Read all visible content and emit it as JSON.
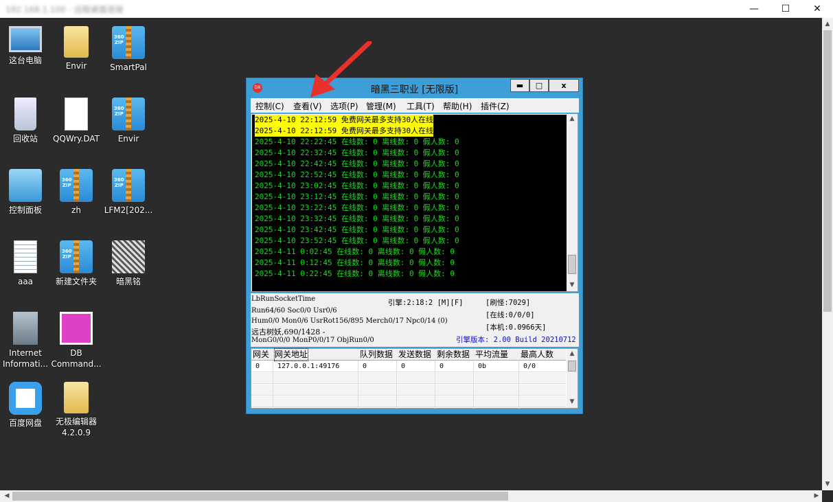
{
  "outer": {
    "title": "192.168.1.100 - 远程桌面连接",
    "minimize": "—",
    "maximize": "☐",
    "close": "✕"
  },
  "desktop_icons": [
    {
      "label": "这台电脑",
      "icon": "computer-icon"
    },
    {
      "label": "Envir",
      "icon": "folder-icon"
    },
    {
      "label": "SmartPal",
      "icon": "zip-icon"
    },
    {
      "label": "回收站",
      "icon": "recycle-bin-icon"
    },
    {
      "label": "QQWry.DAT",
      "icon": "file-icon"
    },
    {
      "label": "Envir",
      "icon": "zip-icon"
    },
    {
      "label": "控制面板",
      "icon": "control-panel-icon"
    },
    {
      "label": "zh",
      "icon": "zip-icon"
    },
    {
      "label": "LFM2[202...",
      "icon": "zip-icon"
    },
    {
      "label": "aaa",
      "icon": "text-file-icon"
    },
    {
      "label": "新建文件夹",
      "icon": "zip-icon"
    },
    {
      "label": "暗黑铭",
      "icon": "dragon-icon"
    },
    {
      "label": "Internet\nInformati...",
      "icon": "iis-icon"
    },
    {
      "label": "DB\nCommand...",
      "icon": "dbc-icon"
    },
    {
      "label": "百度网盘",
      "icon": "baidu-netdisk-icon"
    },
    {
      "label": "无极编辑器\n4.2.0.9",
      "icon": "folder-icon"
    }
  ],
  "app": {
    "title": "暗黑三职业 [无限版]",
    "logo": "DX",
    "btn_min": "▬",
    "btn_max": "□",
    "btn_close": "x",
    "menus": [
      "控制(C)",
      "查看(V)",
      "选项(P)",
      "管理(M)",
      "工具(T)",
      "帮助(H)",
      "插件(Z)"
    ],
    "log": [
      {
        "text": "2025-4-10 22:12:59 免费网关最多支持30人在线",
        "highlight": true
      },
      {
        "text": "2025-4-10 22:12:59 免费网关最多支持30人在线",
        "highlight": true
      },
      {
        "text": "2025-4-10 22:22:45 在线数: 0 离线数: 0 假人数: 0",
        "highlight": false
      },
      {
        "text": "2025-4-10 22:32:45 在线数: 0 离线数: 0 假人数: 0",
        "highlight": false
      },
      {
        "text": "2025-4-10 22:42:45 在线数: 0 离线数: 0 假人数: 0",
        "highlight": false
      },
      {
        "text": "2025-4-10 22:52:45 在线数: 0 离线数: 0 假人数: 0",
        "highlight": false
      },
      {
        "text": "2025-4-10 23:02:45 在线数: 0 离线数: 0 假人数: 0",
        "highlight": false
      },
      {
        "text": "2025-4-10 23:12:45 在线数: 0 离线数: 0 假人数: 0",
        "highlight": false
      },
      {
        "text": "2025-4-10 23:22:45 在线数: 0 离线数: 0 假人数: 0",
        "highlight": false
      },
      {
        "text": "2025-4-10 23:32:45 在线数: 0 离线数: 0 假人数: 0",
        "highlight": false
      },
      {
        "text": "2025-4-10 23:42:45 在线数: 0 离线数: 0 假人数: 0",
        "highlight": false
      },
      {
        "text": "2025-4-10 23:52:45 在线数: 0 离线数: 0 假人数: 0",
        "highlight": false
      },
      {
        "text": "2025-4-11 0:02:45 在线数: 0 离线数: 0 假人数: 0",
        "highlight": false
      },
      {
        "text": "2025-4-11 0:12:45 在线数: 0 离线数: 0 假人数: 0",
        "highlight": false
      },
      {
        "text": "2025-4-11 0:22:45 在线数: 0 离线数: 0 假人数: 0",
        "highlight": false
      }
    ],
    "status": {
      "socket_time": "LbRunSocketTime",
      "engine": "引擎:2:18:2 [M][F]",
      "refresh": "[刷怪:7029]",
      "run": "Run64/60 Soc0/0 Usr0/6",
      "online": "[在线:0/0/0]",
      "hum": "Hum0/0 Mon0/6 UsrRot156/895 Merch0/17 Npc0/14 (0)",
      "local": "[本机:0.0966天]",
      "monster": "远古树妖,690/1428 -",
      "mon": "MonG0/0/0 MonP0/0/17 ObjRun0/0",
      "version": "引擎版本: 2.00 Build 20210712"
    },
    "grid": {
      "headers": [
        "网关",
        "网关地址",
        "队列数据",
        "发送数据",
        "剩余数据",
        "平均流量",
        "最高人数"
      ],
      "rows": [
        [
          "0",
          "127.0.0.1:49176",
          "0",
          "0",
          "0",
          "0b",
          "0/0"
        ]
      ]
    }
  }
}
